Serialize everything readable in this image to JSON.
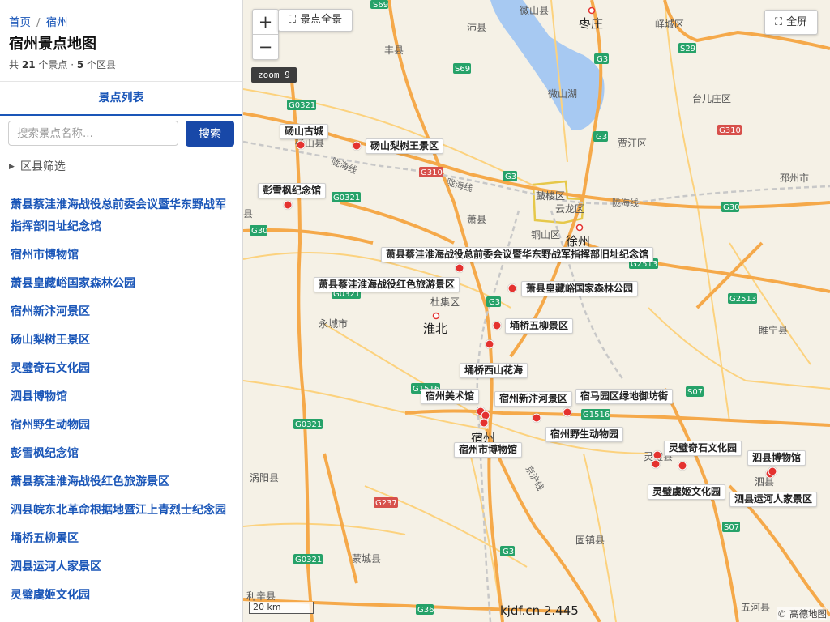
{
  "breadcrumb": {
    "home": "首页",
    "current": "宿州"
  },
  "page_title": "宿州景点地图",
  "stats": {
    "prefix": "共",
    "spot_count": "21",
    "spot_unit": "个景点 ·",
    "county_count": "5",
    "county_unit": "个区县"
  },
  "tab": {
    "label": "景点列表"
  },
  "search": {
    "placeholder": "搜索景点名称...",
    "button": "搜索"
  },
  "filter": {
    "label": "区县筛选"
  },
  "spots": [
    "萧县蔡洼淮海战役总前委会议暨华东野战军指挥部旧址纪念馆",
    "宿州市博物馆",
    "萧县皇藏峪国家森林公园",
    "宿州新汴河景区",
    "砀山梨树王景区",
    "灵璧奇石文化园",
    "泗县博物馆",
    "宿州野生动物园",
    "彭雪枫纪念馆",
    "萧县蔡洼淮海战役红色旅游景区",
    "泗县皖东北革命根据地暨江上青烈士纪念园",
    "埇桥五柳景区",
    "泗县运河人家景区",
    "灵璧虞姬文化园"
  ],
  "map": {
    "controls": {
      "zoom_in": "+",
      "zoom_out": "−",
      "fullview": "景点全景",
      "fullscreen": "全屏",
      "zoom_badge": "zoom 9"
    },
    "scale": "20 km",
    "watermark": "kjdf.cn 2.445",
    "attribution": "© 高德地图",
    "colors": {
      "marker": "#e4322f",
      "road_major": "#f5a94a",
      "road_minor": "#fcd27e",
      "water": "#a7c9f2",
      "boundary": "#e6c84a"
    },
    "poi_labels": {
      "dangshan_old_town": "砀山古城",
      "dangshan_pear": "砀山梨树王景区",
      "peng_xuefeng": "彭雪枫纪念馆",
      "caiwa_hq": "萧县蔡洼淮海战役总前委会议暨华东野战军指挥部旧址纪念馆",
      "caiwa_red": "萧县蔡洼淮海战役红色旅游景区",
      "huangcangyu": "萧县皇藏峪国家森林公园",
      "wuliu": "埇桥五柳景区",
      "xishan": "埇桥西山花海",
      "art_museum": "宿州美术馆",
      "bianhe": "宿州新汴河景区",
      "greenland": "宿马园区绿地御坊街",
      "zoo": "宿州野生动物园",
      "city_museum": "宿州市博物馆",
      "qishi": "灵璧奇石文化园",
      "yuji": "灵璧虞姬文化园",
      "sixian_museum": "泗县博物馆",
      "canal": "泗县运河人家景区"
    },
    "place_names": {
      "weishan_county": "微山县",
      "zaozhuang": "枣庄",
      "yicheng": "峄城区",
      "peixian": "沛县",
      "fengxian": "丰县",
      "weishan_lake": "微山湖",
      "taierzhuang": "台儿庄区",
      "dangshan": "砀山县",
      "jiawang": "贾汪区",
      "pizhou": "邳州市",
      "gulou": "鼓楼区",
      "yunlong": "云龙区",
      "xiaoxian": "萧县",
      "tongshan": "铜山区",
      "xuzhou": "徐州",
      "dujiji": "杜集区",
      "yongcheng": "永城市",
      "huaibei": "淮北",
      "suining": "睢宁县",
      "suzhou": "宿州",
      "lingbi": "灵璧县",
      "sixian": "泗县",
      "woyang": "涡阳县",
      "mengcheng": "蒙城县",
      "guzhen": "固镇县",
      "lixin": "利辛县",
      "wuhe": "五河县",
      "longhai_line": "陇海线",
      "jinghu_line": "京沪线",
      "mengcheng_partial": "县"
    },
    "road_shields": {
      "s69_top": "S69",
      "g3_north": "G3",
      "s29": "S29",
      "s69_mid": "S69",
      "g0321_west": "G0321",
      "g310_east": "G310",
      "g3_mid": "G3",
      "g310_west": "G310",
      "g3_xuzhou": "G3",
      "g0321_b": "G0321",
      "g30_west": "G30",
      "g30_east": "G30",
      "g2513_a": "G2513",
      "g0321_c": "G0321",
      "g3_huaibei": "G3",
      "g2513_b": "G2513",
      "g1516_w": "G1516",
      "g1516_e": "G1516",
      "g0321_d": "G0321",
      "s07_a": "S07",
      "g237": "G237",
      "s07_b": "S07",
      "g3_south": "G3",
      "g0321_e": "G0321",
      "g36": "G36"
    }
  }
}
